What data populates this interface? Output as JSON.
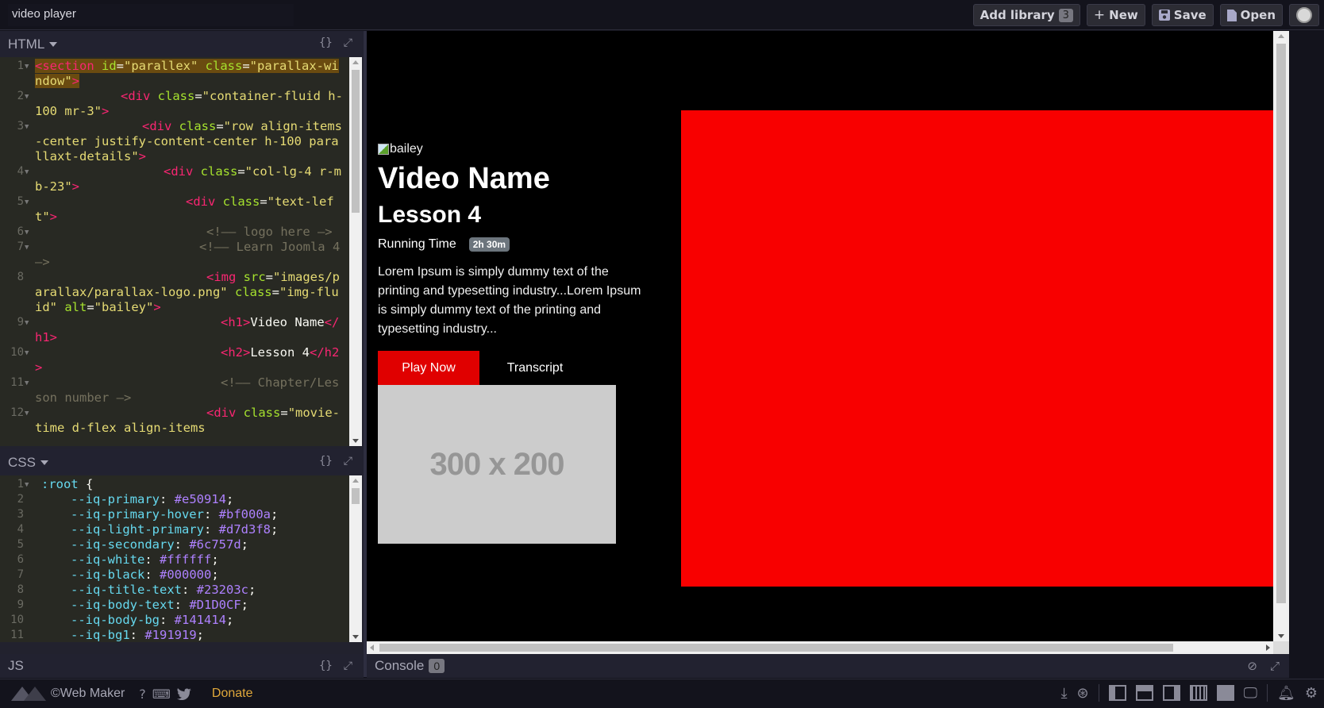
{
  "header": {
    "title": "video player",
    "buttons": {
      "add_library": "Add library",
      "add_library_count": "3",
      "new": "New",
      "save": "Save",
      "open": "Open"
    }
  },
  "editors": {
    "html": {
      "label": "HTML",
      "lines": [
        {
          "n": "1",
          "fold": true
        },
        {
          "n": "2",
          "fold": true
        },
        {
          "n": "3",
          "fold": true
        },
        {
          "n": "4",
          "fold": true
        },
        {
          "n": "5",
          "fold": true
        },
        {
          "n": "6",
          "fold": true
        },
        {
          "n": "7",
          "fold": true
        },
        {
          "n": "8",
          "fold": false
        },
        {
          "n": "9",
          "fold": true
        },
        {
          "n": "10",
          "fold": true
        },
        {
          "n": "11",
          "fold": true
        },
        {
          "n": "12",
          "fold": true
        }
      ],
      "code": {
        "l1": [
          "<section",
          " id",
          "=",
          "\"parallex\"",
          " class",
          "=",
          "\"parallax-window\"",
          ">"
        ],
        "l2": [
          "<div",
          " class",
          "=",
          "\"container-fluid h-100 mr-3\"",
          ">"
        ],
        "l3": [
          "<div",
          " class",
          "=",
          "\"row align-items-center justify-content-center h-100 parallaxt-details\"",
          ">"
        ],
        "l4": [
          "<div",
          " class",
          "=",
          "\"col-lg-4 r-mb-23\"",
          ">"
        ],
        "l5": [
          "<div",
          " class",
          "=",
          "\"text-left\"",
          ">"
        ],
        "l6": "<!—— logo here —>",
        "l7": "<!—— Learn Joomla 4 —>",
        "l8": [
          "<img",
          "src",
          "=",
          "\"images/parallax/parallax-logo.png\"",
          "class",
          "=",
          "\"img-fluid\"",
          " alt",
          "=",
          "\"bailey\"",
          ">"
        ],
        "l9": [
          "<h1>",
          "Video Name",
          "</h1>"
        ],
        "l10": [
          "<h2>",
          "Lesson 4",
          "</h2>"
        ],
        "l11": "<!—— Chapter/Lesson number —>",
        "l12": [
          "<div",
          "class",
          "=",
          "\"movie-time d-flex align-items"
        ]
      }
    },
    "css": {
      "label": "CSS",
      "lines": [
        {
          "n": "1",
          "text_sel": ":root",
          "brace": " {"
        },
        {
          "n": "2",
          "prop": "--iq-primary",
          "val": "#e50914"
        },
        {
          "n": "3",
          "prop": "--iq-primary-hover",
          "val": "#bf000a"
        },
        {
          "n": "4",
          "prop": "--iq-light-primary",
          "val": "#d7d3f8"
        },
        {
          "n": "5",
          "prop": "--iq-secondary",
          "val": "#6c757d"
        },
        {
          "n": "6",
          "prop": "--iq-white",
          "val": "#ffffff"
        },
        {
          "n": "7",
          "prop": "--iq-black",
          "val": "#000000"
        },
        {
          "n": "8",
          "prop": "--iq-title-text",
          "val": "#23203c"
        },
        {
          "n": "9",
          "prop": "--iq-body-text",
          "val": "#D1D0CF"
        },
        {
          "n": "10",
          "prop": "--iq-body-bg",
          "val": "#141414"
        },
        {
          "n": "11",
          "prop": "--iq-bg1",
          "val": "#191919"
        }
      ]
    },
    "js": {
      "label": "JS"
    }
  },
  "preview": {
    "img_alt": "bailey",
    "title": "Video Name",
    "lesson": "Lesson 4",
    "running_time_label": "Running Time",
    "running_time_value": "2h 30m",
    "description": "Lorem Ipsum is simply dummy text of the printing and typesetting industry...Lorem Ipsum is simply dummy text of the printing and typesetting industry...",
    "play_button": "Play Now",
    "transcript_button": "Transcript",
    "placeholder_text": "300 x 200",
    "colors": {
      "play": "#e00000",
      "video": "#f80000",
      "badge": "#6c757d"
    }
  },
  "console": {
    "label": "Console",
    "count": "0"
  },
  "footer": {
    "brand": "©Web Maker",
    "donate": "Donate"
  }
}
